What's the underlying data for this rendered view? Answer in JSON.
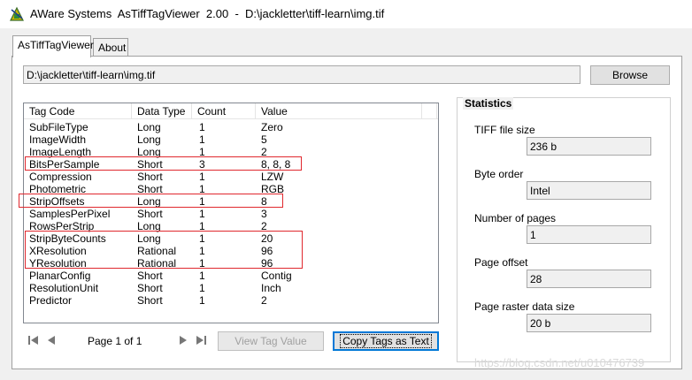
{
  "window": {
    "title": "AWare Systems  AsTiffTagViewer  2.00  -  D:\\jackletter\\tiff-learn\\img.tif"
  },
  "tabs": [
    {
      "label": "AsTiffTagViewer",
      "active": true
    },
    {
      "label": "About",
      "active": false
    }
  ],
  "file": {
    "path": "D:\\jackletter\\tiff-learn\\img.tif",
    "browse_label": "Browse"
  },
  "tag_table": {
    "columns": [
      "Tag Code",
      "Data Type",
      "Count",
      "Value"
    ],
    "rows": [
      {
        "tag": "SubFileType",
        "type": "Long",
        "count": "1",
        "value": "Zero"
      },
      {
        "tag": "ImageWidth",
        "type": "Long",
        "count": "1",
        "value": "5"
      },
      {
        "tag": "ImageLength",
        "type": "Long",
        "count": "1",
        "value": "2"
      },
      {
        "tag": "BitsPerSample",
        "type": "Short",
        "count": "3",
        "value": "8, 8, 8"
      },
      {
        "tag": "Compression",
        "type": "Short",
        "count": "1",
        "value": "LZW"
      },
      {
        "tag": "Photometric",
        "type": "Short",
        "count": "1",
        "value": "RGB"
      },
      {
        "tag": "StripOffsets",
        "type": "Long",
        "count": "1",
        "value": "8"
      },
      {
        "tag": "SamplesPerPixel",
        "type": "Short",
        "count": "1",
        "value": "3"
      },
      {
        "tag": "RowsPerStrip",
        "type": "Long",
        "count": "1",
        "value": "2"
      },
      {
        "tag": "StripByteCounts",
        "type": "Long",
        "count": "1",
        "value": "20"
      },
      {
        "tag": "XResolution",
        "type": "Rational",
        "count": "1",
        "value": "96"
      },
      {
        "tag": "YResolution",
        "type": "Rational",
        "count": "1",
        "value": "96"
      },
      {
        "tag": "PlanarConfig",
        "type": "Short",
        "count": "1",
        "value": "Contig"
      },
      {
        "tag": "ResolutionUnit",
        "type": "Short",
        "count": "1",
        "value": "Inch"
      },
      {
        "tag": "Predictor",
        "type": "Short",
        "count": "1",
        "value": "2"
      }
    ]
  },
  "pager": {
    "label": "Page 1 of 1",
    "view_tag_value_label": "View Tag Value",
    "copy_tags_label": "Copy Tags as Text"
  },
  "statistics": {
    "title": "Statistics",
    "items": [
      {
        "label": "TIFF file size",
        "value": "236 b"
      },
      {
        "label": "Byte order",
        "value": "Intel"
      },
      {
        "label": "Number of pages",
        "value": "1"
      },
      {
        "label": "Page offset",
        "value": "28"
      },
      {
        "label": "Page raster data size",
        "value": "20 b"
      }
    ]
  },
  "watermark": "https://blog.csdn.net/u010476739",
  "colors": {
    "highlight_box": "#e0282e",
    "focus_border": "#0078d7"
  },
  "icons": {
    "app": "tiff-viewer-app-icon",
    "first_page": "first-page-icon",
    "prev_page": "prev-page-icon",
    "next_page": "next-page-icon",
    "last_page": "last-page-icon"
  }
}
